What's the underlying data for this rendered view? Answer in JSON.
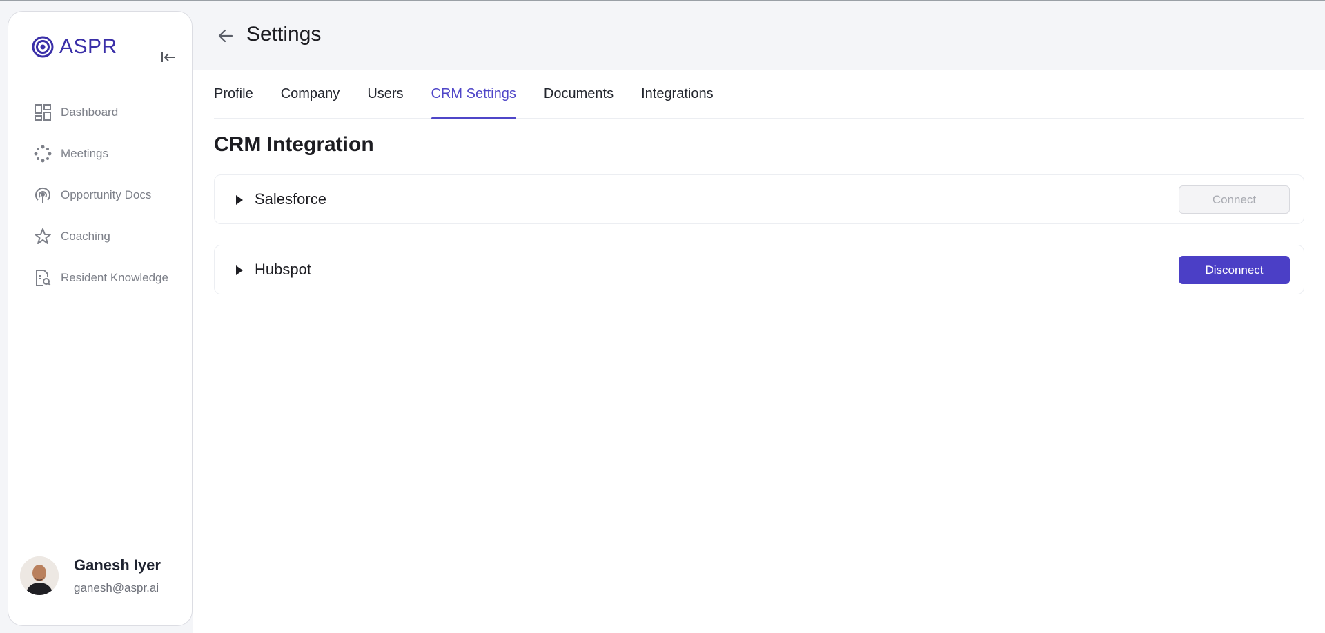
{
  "app": {
    "brand": "ASPR"
  },
  "sidebar": {
    "collapse_icon": "collapse-left-icon",
    "items": [
      {
        "label": "Dashboard",
        "icon": "dashboard-icon"
      },
      {
        "label": "Meetings",
        "icon": "meetings-icon"
      },
      {
        "label": "Opportunity Docs",
        "icon": "podcast-icon"
      },
      {
        "label": "Coaching",
        "icon": "star-icon"
      },
      {
        "label": "Resident Knowledge",
        "icon": "document-search-icon"
      }
    ],
    "user": {
      "name": "Ganesh Iyer",
      "email": "ganesh@aspr.ai"
    }
  },
  "header": {
    "title": "Settings",
    "back_icon": "arrow-left-icon"
  },
  "tabs": [
    {
      "label": "Profile",
      "active": false
    },
    {
      "label": "Company",
      "active": false
    },
    {
      "label": "Users",
      "active": false
    },
    {
      "label": "CRM Settings",
      "active": true
    },
    {
      "label": "Documents",
      "active": false
    },
    {
      "label": "Integrations",
      "active": false
    }
  ],
  "crm": {
    "title": "CRM Integration",
    "items": [
      {
        "name": "Salesforce",
        "button": "Connect",
        "button_state": "disabled"
      },
      {
        "name": "Hubspot",
        "button": "Disconnect",
        "button_state": "primary"
      }
    ]
  },
  "colors": {
    "accent": "#4b3fc6",
    "brand": "#3a2fa8",
    "background": "#f4f5f8"
  }
}
